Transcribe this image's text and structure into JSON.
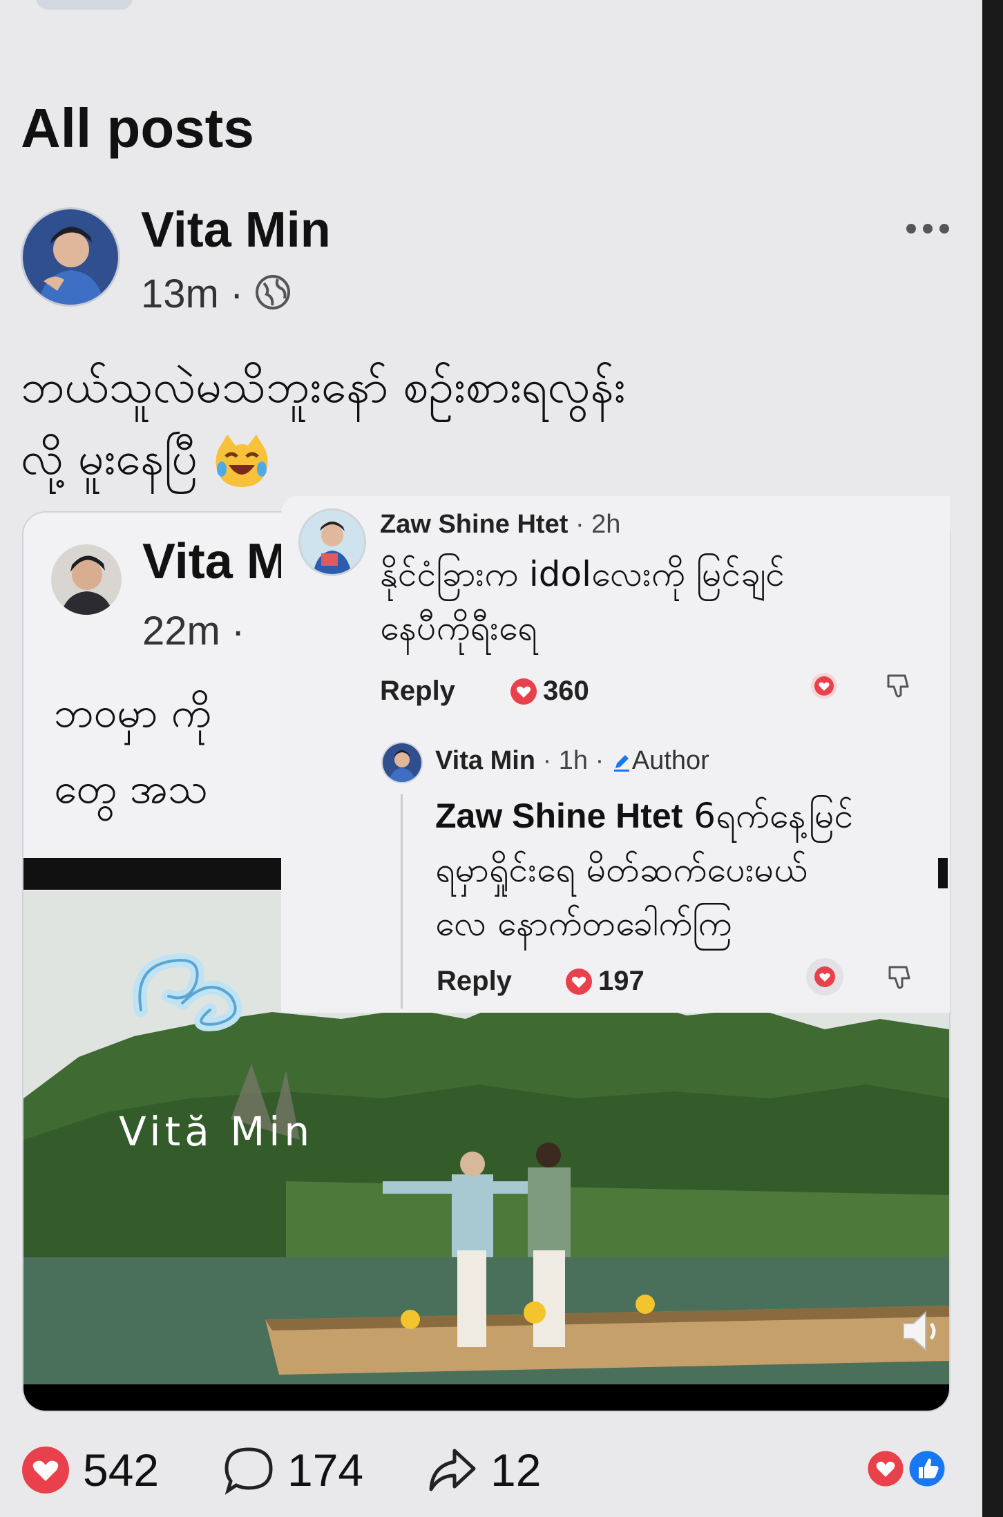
{
  "section": {
    "title": "All posts"
  },
  "post": {
    "author": "Vita Min",
    "time": "13m",
    "text_line1": "ဘယ်သူလဲမသိဘူးနော် စဉ်းစားရလွန်း",
    "text_line2": "လို့ မူးနေပြီ",
    "emoji": "crying-laughing-cat-emoji"
  },
  "shared": {
    "author": "Vita M",
    "time": "22m ·",
    "text_line1": "ဘဝမှာ ကို",
    "text_line2": "တွေ အသ",
    "watermark_text": "Vită Min"
  },
  "comments": {
    "first": {
      "author": "Zaw Shine Htet",
      "time": "· 2h",
      "text_line1": "နိုင်ငံခြားက idolလေးကို မြင်ချင်",
      "text_line2": "နေပီကိုရီးရေ",
      "reply_label": "Reply",
      "likes": "360"
    },
    "reply": {
      "author": "Vita Min",
      "time": "· 1h ·",
      "badge": "Author",
      "mention": "Zaw Shine Htet",
      "text_line1": " 6ရက်နေ့မြင်",
      "text_line2": "ရမှာရှိုင်းရေ မိတ်ဆက်ပေးမယ်",
      "text_line3": "လေ နောက်တခေါက်ကြ",
      "reply_label": "Reply",
      "likes": "197"
    }
  },
  "actions": {
    "likes": "542",
    "comments": "174",
    "shares": "12"
  },
  "colors": {
    "background": "#e9e9ec",
    "like_red": "#e8414b",
    "facebook_blue": "#1877f2"
  }
}
